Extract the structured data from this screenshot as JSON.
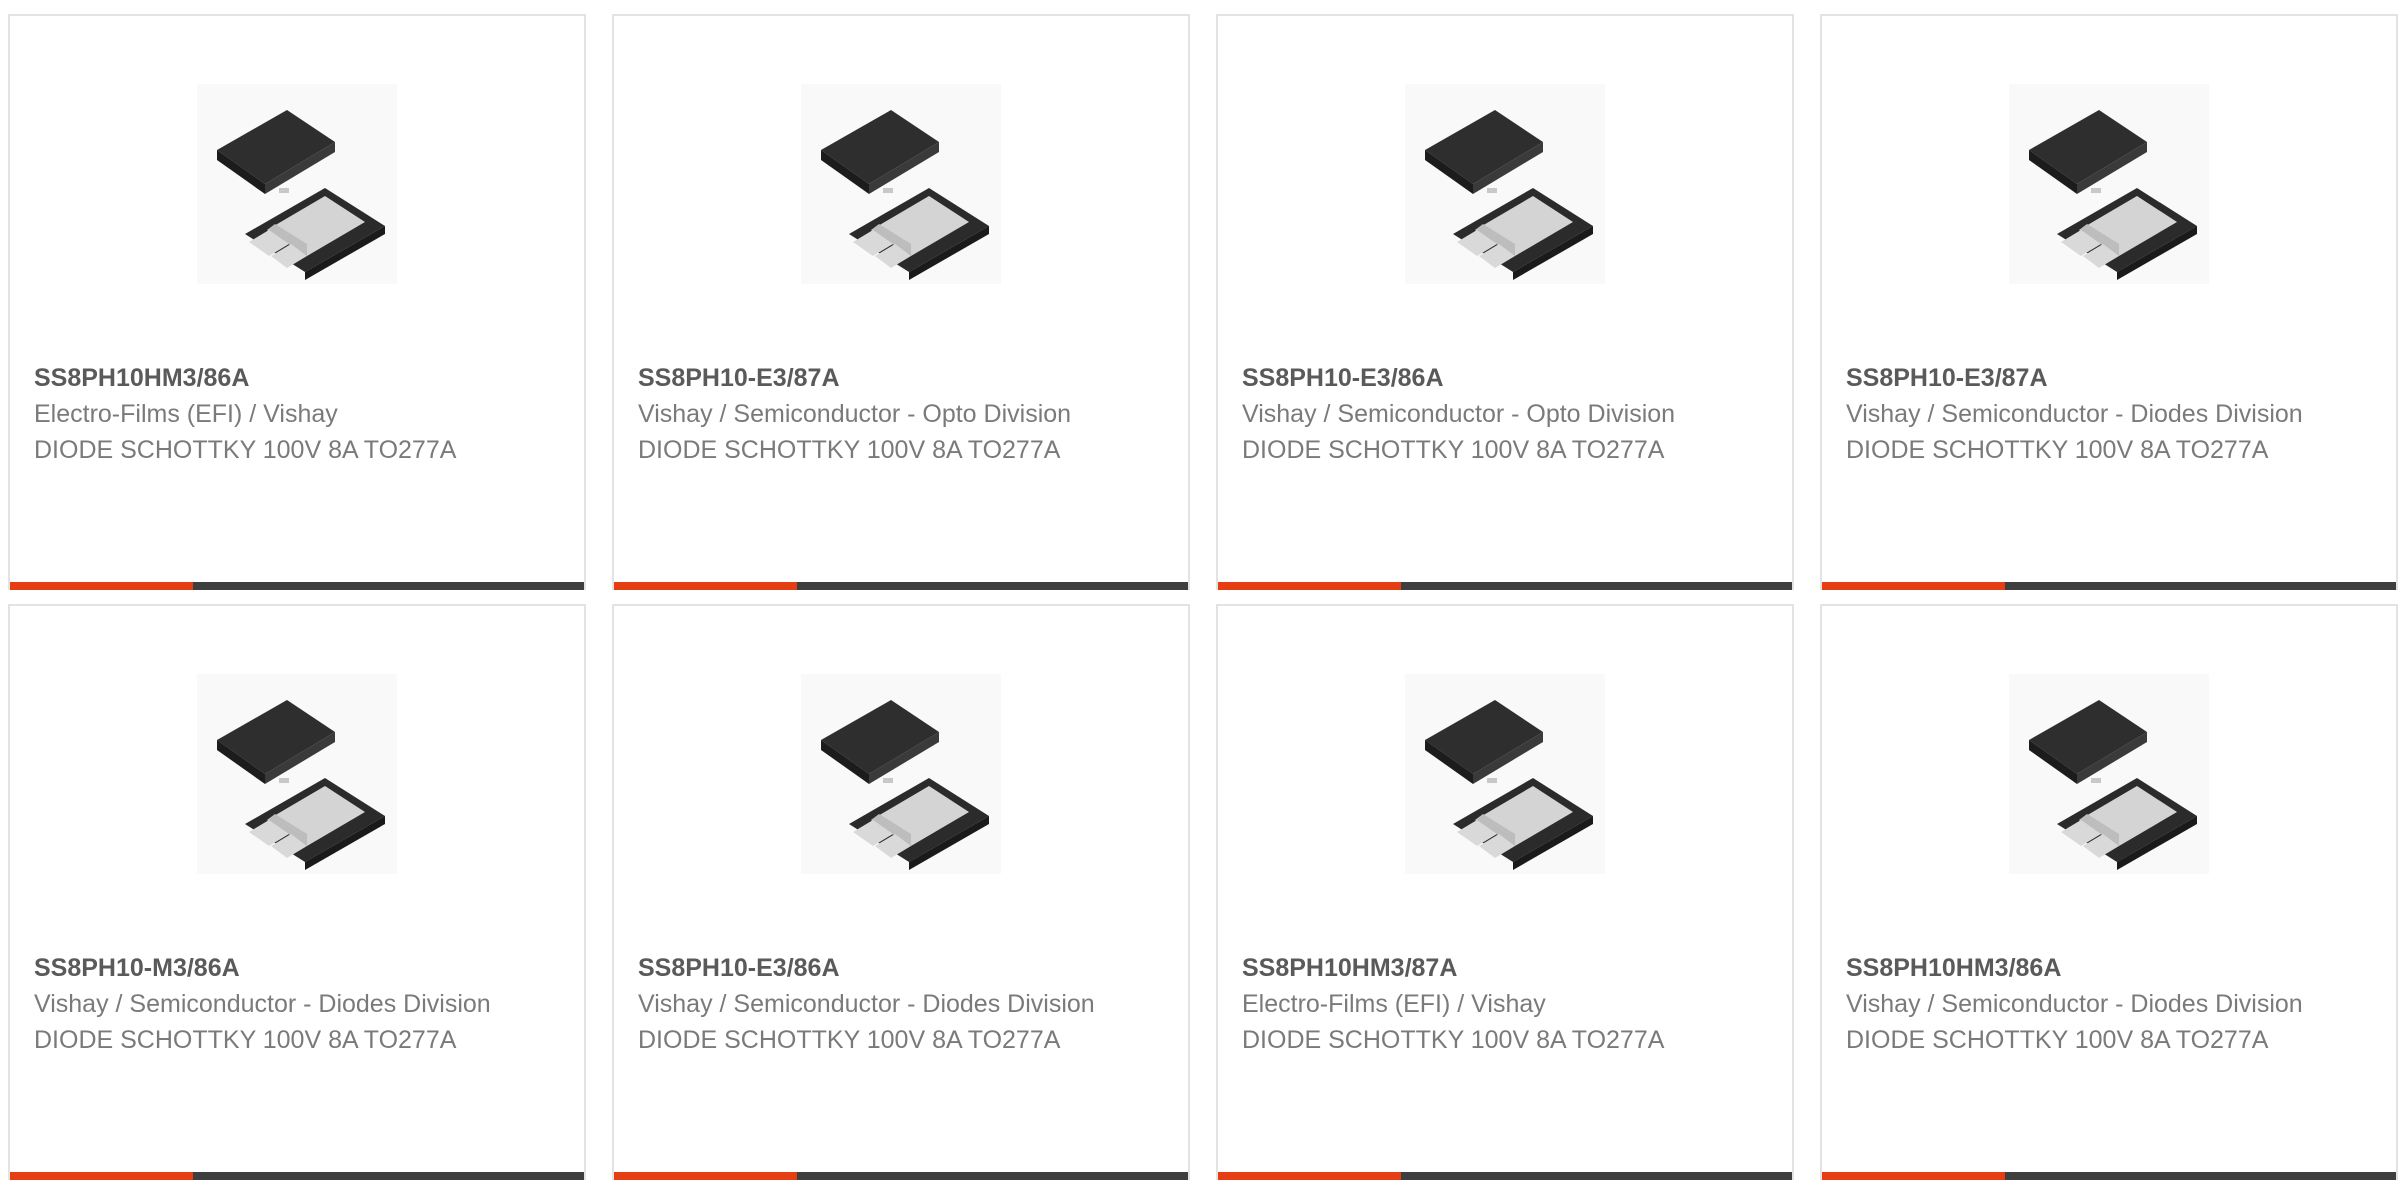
{
  "colors": {
    "accent": "#e63e13",
    "bar": "#3e3e3e",
    "title": "#5a5a5a",
    "text": "#7a7a7a",
    "border": "#e3e3e3"
  },
  "products": [
    {
      "part_number": "SS8PH10HM3/86A",
      "manufacturer": "Electro-Films (EFI) / Vishay",
      "description": "DIODE SCHOTTKY 100V 8A TO277A",
      "image_icon": "diode-package-icon"
    },
    {
      "part_number": "SS8PH10-E3/87A",
      "manufacturer": "Vishay / Semiconductor - Opto Division",
      "description": "DIODE SCHOTTKY 100V 8A TO277A",
      "image_icon": "diode-package-icon"
    },
    {
      "part_number": "SS8PH10-E3/86A",
      "manufacturer": "Vishay / Semiconductor - Opto Division",
      "description": "DIODE SCHOTTKY 100V 8A TO277A",
      "image_icon": "diode-package-icon"
    },
    {
      "part_number": "SS8PH10-E3/87A",
      "manufacturer": "Vishay / Semiconductor - Diodes Division",
      "description": "DIODE SCHOTTKY 100V 8A TO277A",
      "image_icon": "diode-package-icon"
    },
    {
      "part_number": "SS8PH10-M3/86A",
      "manufacturer": "Vishay / Semiconductor - Diodes Division",
      "description": "DIODE SCHOTTKY 100V 8A TO277A",
      "image_icon": "diode-package-icon"
    },
    {
      "part_number": "SS8PH10-E3/86A",
      "manufacturer": "Vishay / Semiconductor - Diodes Division",
      "description": "DIODE SCHOTTKY 100V 8A TO277A",
      "image_icon": "diode-package-icon"
    },
    {
      "part_number": "SS8PH10HM3/87A",
      "manufacturer": "Electro-Films (EFI) / Vishay",
      "description": "DIODE SCHOTTKY 100V 8A TO277A",
      "image_icon": "diode-package-icon"
    },
    {
      "part_number": "SS8PH10HM3/86A",
      "manufacturer": "Vishay / Semiconductor - Diodes Division",
      "description": "DIODE SCHOTTKY 100V 8A TO277A",
      "image_icon": "diode-package-icon"
    }
  ]
}
